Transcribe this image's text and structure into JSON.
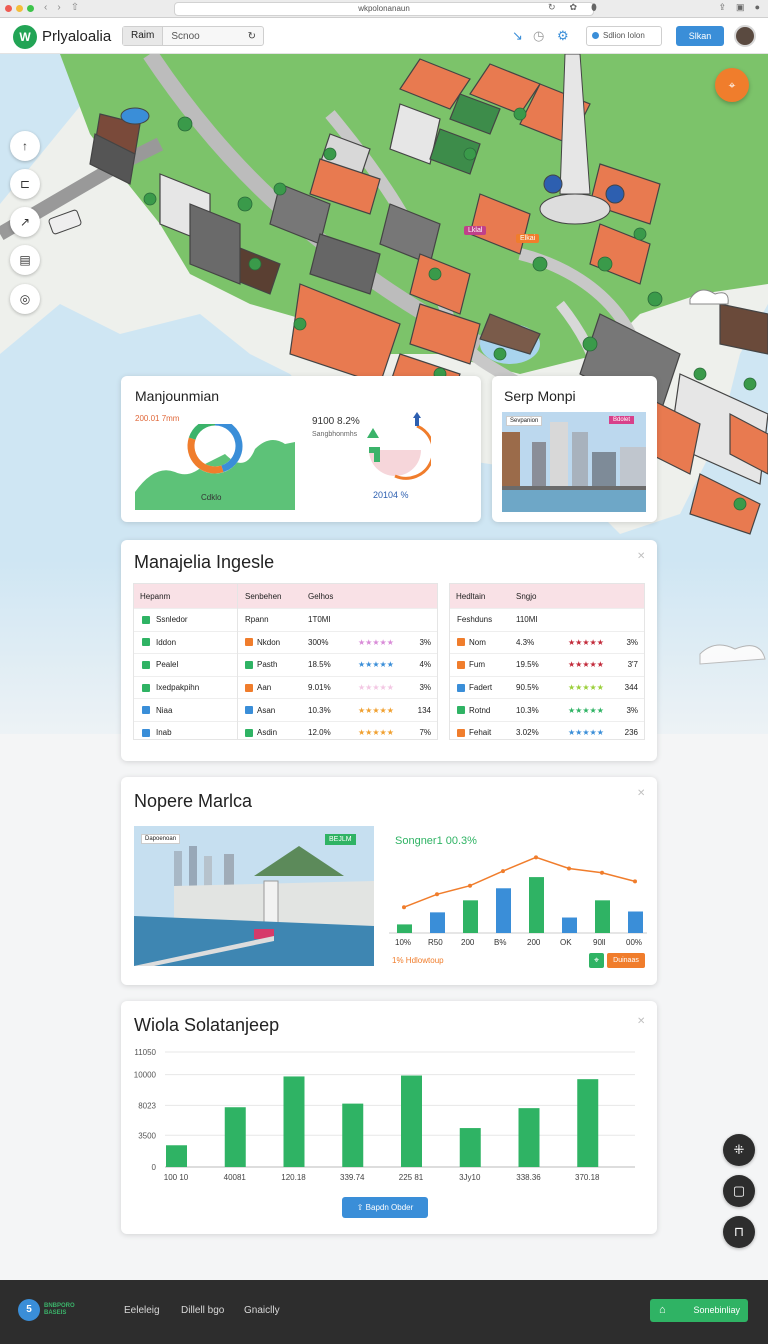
{
  "browser": {
    "url": "wkpolonanaun"
  },
  "header": {
    "brand": "Prlyaloalia",
    "search_tag": "Raim",
    "search_placeholder": "Scnoo",
    "status_label": "Sdlion Iolon",
    "primary_button": "Slkan"
  },
  "map": {
    "label_pink": "Lklal",
    "label_orange": "Elkai"
  },
  "card1": {
    "title": "Manjounmian",
    "subtitle": "200.01 7mm",
    "donut_label": "Cdklo",
    "metric_1": "9100 8.2%",
    "metric_1_sub": "Sangbhonmhs",
    "metric_2": "20104 %",
    "donut_segments": [
      {
        "label": "blue",
        "value": 45,
        "color": "#3a8ed8"
      },
      {
        "label": "orange",
        "value": 35,
        "color": "#f07d2c"
      },
      {
        "label": "green",
        "value": 20,
        "color": "#3bb36a"
      }
    ]
  },
  "card2": {
    "title": "Serp Monpi",
    "photo_tag": "Sevpanion",
    "photo_badge": "Bdolet"
  },
  "card3": {
    "title": "Manajelia Ingesle",
    "left_table": {
      "header": "Hepanm",
      "rows": [
        {
          "label": "Ssnledor",
          "color": "#2fb364"
        },
        {
          "label": "Iddon",
          "color": "#2fb364"
        },
        {
          "label": "Pealel",
          "color": "#2fb364"
        },
        {
          "label": "Ixedpakpihn",
          "color": "#2fb364"
        },
        {
          "label": "Niaa",
          "color": "#3a8ed8"
        },
        {
          "label": "Inab",
          "color": "#3a8ed8"
        }
      ]
    },
    "mid_table": {
      "headers": [
        "Senbehen",
        "Gelhos"
      ],
      "rows": [
        {
          "name": "Rpann",
          "value": "1T0MI",
          "stars": "",
          "star_color": "",
          "pct": "",
          "color": ""
        },
        {
          "name": "Nkdon",
          "value": "300%",
          "stars": "★★★★★",
          "star_color": "#d98bd8",
          "pct": "3%",
          "color": "#f07d2c"
        },
        {
          "name": "Pasth",
          "value": "18.5%",
          "stars": "★★★★★",
          "star_color": "#3a8ed8",
          "pct": "4%",
          "color": "#2fb364"
        },
        {
          "name": "Aan",
          "value": "9.01%",
          "stars": "★★★★★",
          "star_color": "#f3c7e3",
          "pct": "3%",
          "color": "#f07d2c"
        },
        {
          "name": "Asan",
          "value": "10.3%",
          "stars": "★★★★★",
          "star_color": "#f0a030",
          "pct": "134",
          "color": "#3a8ed8"
        },
        {
          "name": "Asdin",
          "value": "12.0%",
          "stars": "★★★★★",
          "star_color": "#f0a030",
          "pct": "7%",
          "color": "#2fb364"
        }
      ]
    },
    "right_table": {
      "headers": [
        "Hedltain",
        "Sngjo"
      ],
      "rows": [
        {
          "name": "Feshduns",
          "value": "110MI",
          "stars": "",
          "star_color": "",
          "pct": "",
          "color": ""
        },
        {
          "name": "Nom",
          "value": "4.3%",
          "stars": "★★★★★",
          "star_color": "#c22a3a",
          "pct": "3%",
          "color": "#f07d2c"
        },
        {
          "name": "Fum",
          "value": "19.5%",
          "stars": "★★★★★",
          "star_color": "#c22a3a",
          "pct": "3'7",
          "color": "#f07d2c"
        },
        {
          "name": "Fadert",
          "value": "90.5%",
          "stars": "★★★★★",
          "star_color": "#9bcf3a",
          "pct": "344",
          "color": "#3a8ed8"
        },
        {
          "name": "Rotnd",
          "value": "10.3%",
          "stars": "★★★★★",
          "star_color": "#2fb364",
          "pct": "3%",
          "color": "#2fb364"
        },
        {
          "name": "Fehait",
          "value": "3.02%",
          "stars": "★★★★★",
          "star_color": "#3a8ed8",
          "pct": "236",
          "color": "#f07d2c"
        }
      ]
    }
  },
  "card4": {
    "title": "Nopere Marlca",
    "photo_tag": "Dapoenoan",
    "photo_badge": "BEJLM",
    "chart_title": "Songner1 00.3%",
    "footer_text": "1% Hdlowtoup",
    "action_label": "Duinaas"
  },
  "card5": {
    "title": "Wiola Solatanjeep",
    "button_label": "Bapdn Obder"
  },
  "chart_data": [
    {
      "type": "bar",
      "title": "Songner1 00.3%",
      "categories": [
        "10%",
        "R50",
        "200",
        "B%",
        "200",
        "OK",
        "90ll",
        "00%"
      ],
      "series": [
        {
          "values": [
            10,
            24,
            38,
            52,
            65,
            18,
            38,
            25
          ],
          "color_cycle": [
            "#2fb364",
            "#3a8ed8"
          ]
        }
      ],
      "line": {
        "values": [
          30,
          45,
          55,
          72,
          88,
          75,
          70,
          60
        ],
        "color": "#f07d2c"
      },
      "ylim": [
        0,
        100
      ]
    },
    {
      "type": "bar",
      "title": "Wiola Solatanjeep",
      "categories": [
        "100 10",
        "40081",
        "120.18",
        "339.74",
        "225 81",
        "3Jy10",
        "338.36",
        "370.18"
      ],
      "values": [
        2400,
        6600,
        10000,
        7000,
        10100,
        4300,
        6500,
        9700
      ],
      "yticks": [
        "0",
        "3500",
        "8023",
        "10000",
        "11050"
      ],
      "ytick_values": [
        0,
        3500,
        6800,
        10200,
        12700
      ],
      "ylim": [
        0,
        12700
      ],
      "color": "#2fb364"
    }
  ],
  "footer": {
    "brand_line1": "BNBPORO",
    "brand_line2": "BASEIS",
    "links": [
      "Eeleleig",
      "Dillell bgo",
      "Gnaiclly"
    ],
    "cta": "Sonebinliay"
  }
}
